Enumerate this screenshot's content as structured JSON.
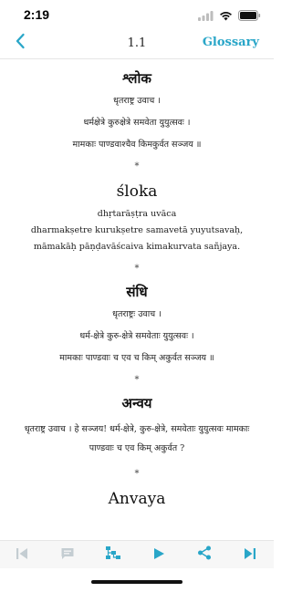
{
  "status": {
    "time": "2:19"
  },
  "nav": {
    "title": "1.1",
    "glossary_label": "Glossary"
  },
  "sections": {
    "shloka": {
      "heading": "श्लोक",
      "lines": [
        "धृतराष्ट्र उवाच ।",
        "धर्मक्षेत्रे कुरुक्षेत्रे समवेता युयुत्सवः ।",
        "मामकाः पाण्डवाश्चैव किमकुर्वत सञ्जय ॥"
      ]
    },
    "sloka": {
      "heading": "śloka",
      "lines": [
        "dhṛtarāṣṭra uvāca",
        "dharmakṣetre kurukṣetre samavetā yuyutsavaḥ,",
        "māmakāḥ pāṇḍavāścaiva kimakurvata sañjaya."
      ]
    },
    "sandhi": {
      "heading": "संधि",
      "lines": [
        "धृतराष्ट्रः उवाच ।",
        "धर्म-क्षेत्रे कुरु-क्षेत्रे समवेताः युयुत्सवः ।",
        "मामकाः पाण्डवाः च एव च किम् अकुर्वत सञ्जय ॥"
      ]
    },
    "anvaya": {
      "heading": "अन्वय",
      "text": "धृतराष्ट्र उवाच । हे सञ्जय! धर्म-क्षेत्रे, कुरु-क्षेत्रे, समवेताः युयुत्सवः मामकाः पाण्डवाः च एव किम् अकुर्वत ?"
    },
    "anvaya_latin": {
      "heading": "Anvaya"
    }
  },
  "separator": "*",
  "toolbar": {
    "first_icon": "skip-to-first-icon",
    "comment_icon": "comment-icon",
    "tree_icon": "tree-icon",
    "play_icon": "play-icon",
    "share_icon": "share-icon",
    "last_icon": "skip-to-last-icon"
  },
  "colors": {
    "accent": "#29a6c8",
    "disabled": "#c4cdd2"
  }
}
